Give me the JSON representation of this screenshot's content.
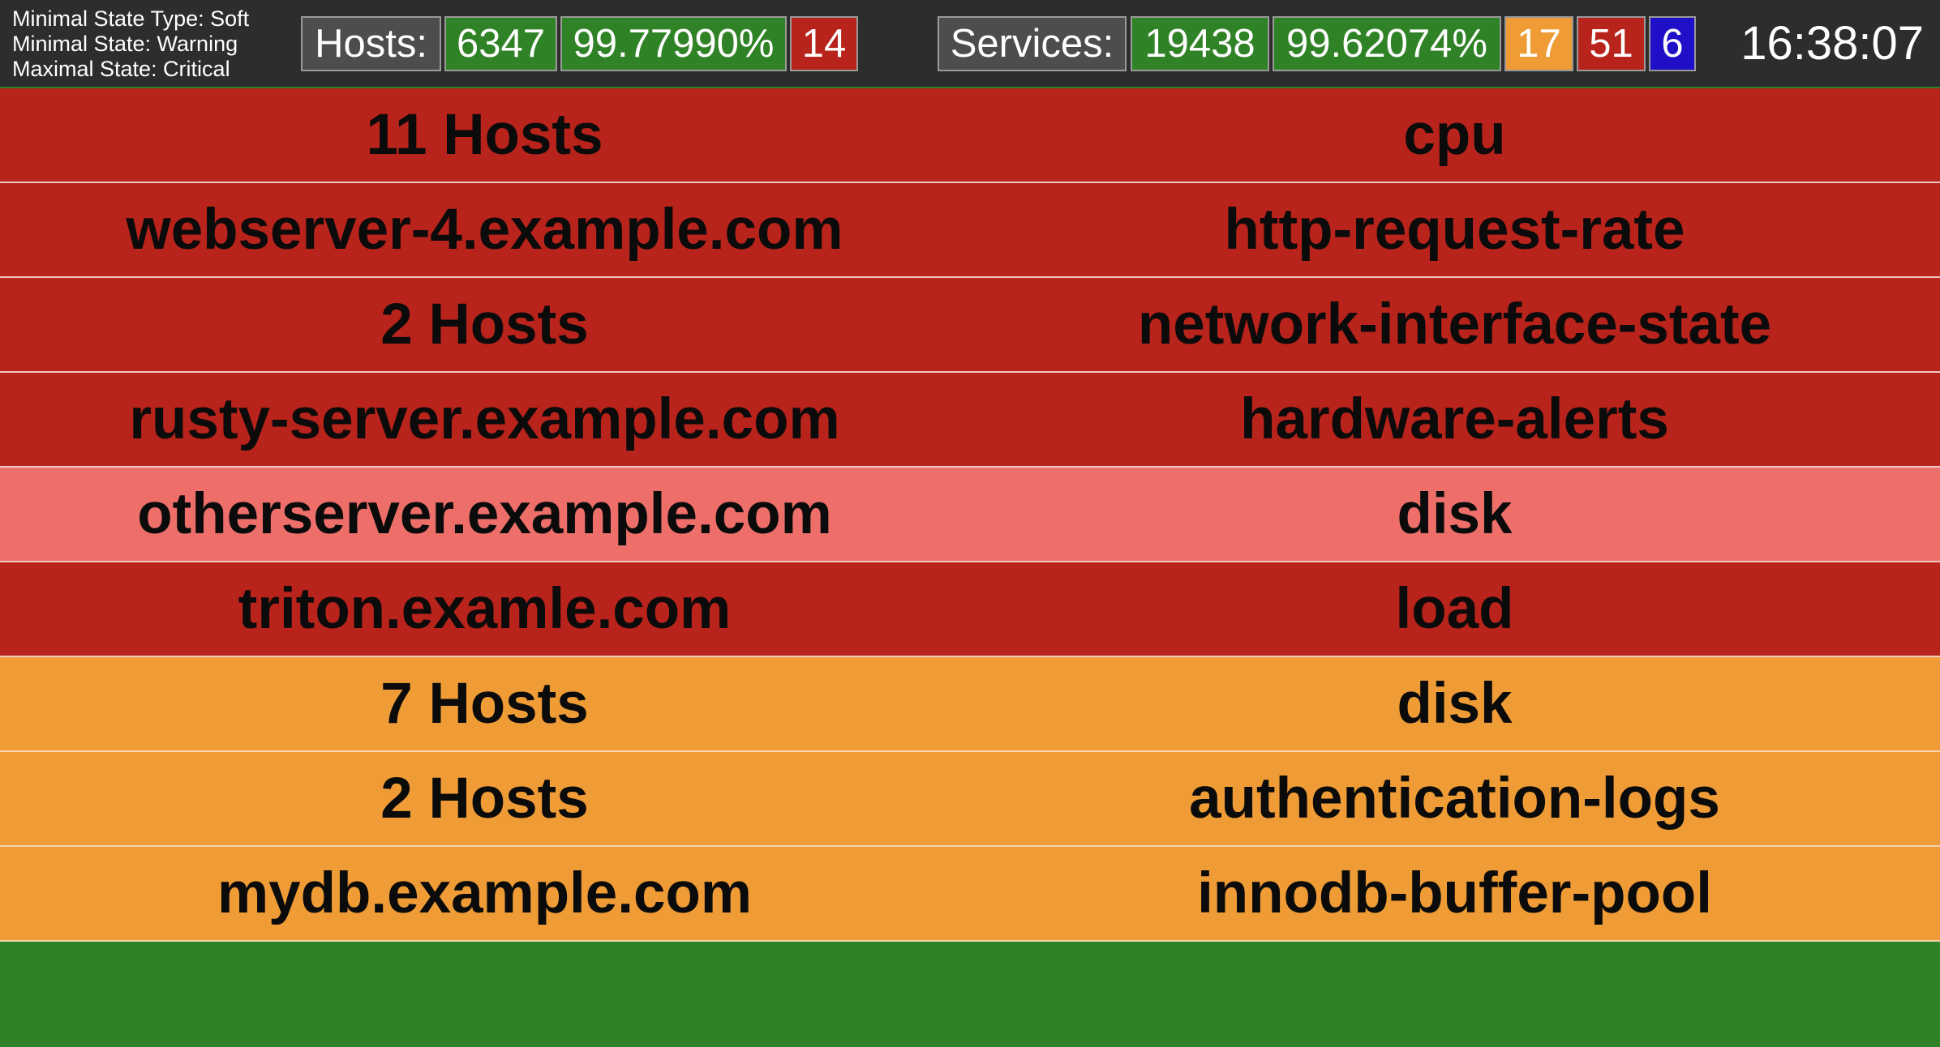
{
  "state_info": {
    "min_state_type": "Minimal State Type: Soft",
    "min_state": "Minimal State: Warning",
    "max_state": "Maximal State: Critical"
  },
  "hosts_summary": {
    "label": "Hosts:",
    "total": "6347",
    "availability": "99.77990%",
    "down": "14"
  },
  "services_summary": {
    "label": "Services:",
    "total": "19438",
    "availability": "99.62074%",
    "warning": "17",
    "critical": "51",
    "unknown": "6"
  },
  "clock": "16:38:07",
  "colors": {
    "critical": "#b8231b",
    "critical_soft": "#ee6f6a",
    "warning": "#f09c36",
    "ok": "#2f8326",
    "unknown": "#1f0fc8",
    "header_bg": "#2d2d2d"
  },
  "problems": [
    {
      "host": "11 Hosts",
      "service": "cpu",
      "state": "critical"
    },
    {
      "host": "webserver-4.example.com",
      "service": "http-request-rate",
      "state": "critical"
    },
    {
      "host": "2 Hosts",
      "service": "network-interface-state",
      "state": "critical"
    },
    {
      "host": "rusty-server.example.com",
      "service": "hardware-alerts",
      "state": "critical"
    },
    {
      "host": "otherserver.example.com",
      "service": "disk",
      "state": "critical-soft"
    },
    {
      "host": "triton.examle.com",
      "service": "load",
      "state": "critical"
    },
    {
      "host": "7 Hosts",
      "service": "disk",
      "state": "warning"
    },
    {
      "host": "2 Hosts",
      "service": "authentication-logs",
      "state": "warning"
    },
    {
      "host": "mydb.example.com",
      "service": "innodb-buffer-pool",
      "state": "warning"
    }
  ]
}
